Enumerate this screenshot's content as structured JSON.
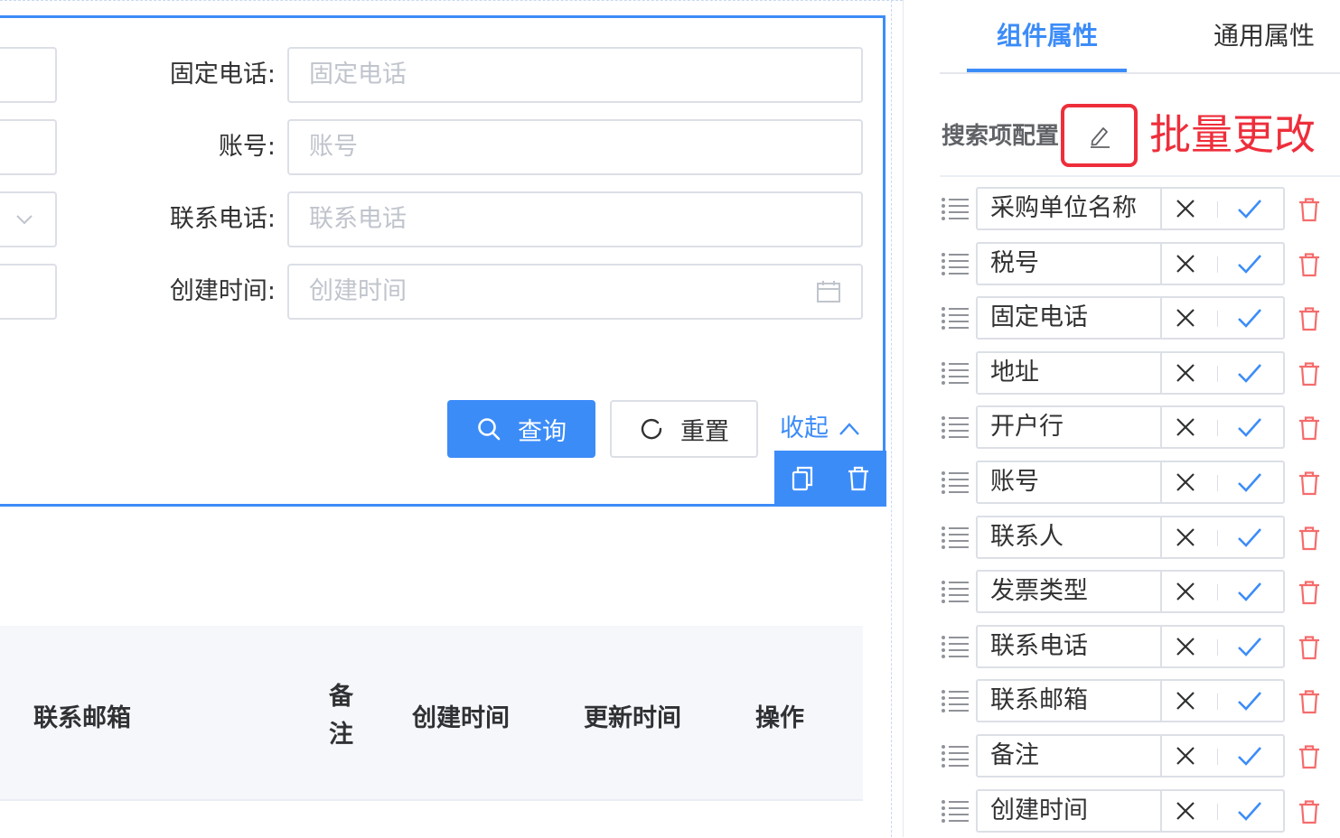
{
  "form": {
    "fields": [
      {
        "label": "固定电话:",
        "placeholder": "固定电话",
        "type": "text"
      },
      {
        "label": "账号:",
        "placeholder": "账号",
        "type": "text"
      },
      {
        "label": "联系电话:",
        "placeholder": "联系电话",
        "type": "text"
      },
      {
        "label": "创建时间:",
        "placeholder": "创建时间",
        "type": "date"
      }
    ],
    "query_label": "查询",
    "reset_label": "重置",
    "collapse_label": "收起"
  },
  "table": {
    "columns": [
      "联系邮箱",
      "备注",
      "创建时间",
      "更新时间",
      "操作"
    ]
  },
  "panel": {
    "tabs": [
      {
        "label": "组件属性",
        "active": true
      },
      {
        "label": "通用属性",
        "active": false
      }
    ],
    "section_title": "搜索项配置",
    "batch_edit_annotation": "批量更改",
    "search_items": [
      {
        "label": "采购单位名称"
      },
      {
        "label": "税号"
      },
      {
        "label": "固定电话"
      },
      {
        "label": "地址"
      },
      {
        "label": "开户行"
      },
      {
        "label": "账号"
      },
      {
        "label": "联系人"
      },
      {
        "label": "发票类型"
      },
      {
        "label": "联系电话"
      },
      {
        "label": "联系邮箱"
      },
      {
        "label": "备注"
      },
      {
        "label": "创建时间"
      }
    ]
  },
  "colors": {
    "primary": "#3c8cf8",
    "danger": "#ee2e3b",
    "delete_icon": "#f56c6c",
    "border": "#dcdfe6"
  },
  "icons": {
    "query": "search-icon",
    "reset": "refresh-icon",
    "collapse": "chevron-up-icon",
    "copy": "copy-icon",
    "delete": "trash-icon",
    "date": "calendar-icon",
    "select": "chevron-down-icon",
    "drag": "drag-handle-icon",
    "edit": "pencil-icon",
    "clear": "close-icon",
    "confirm": "check-icon"
  }
}
